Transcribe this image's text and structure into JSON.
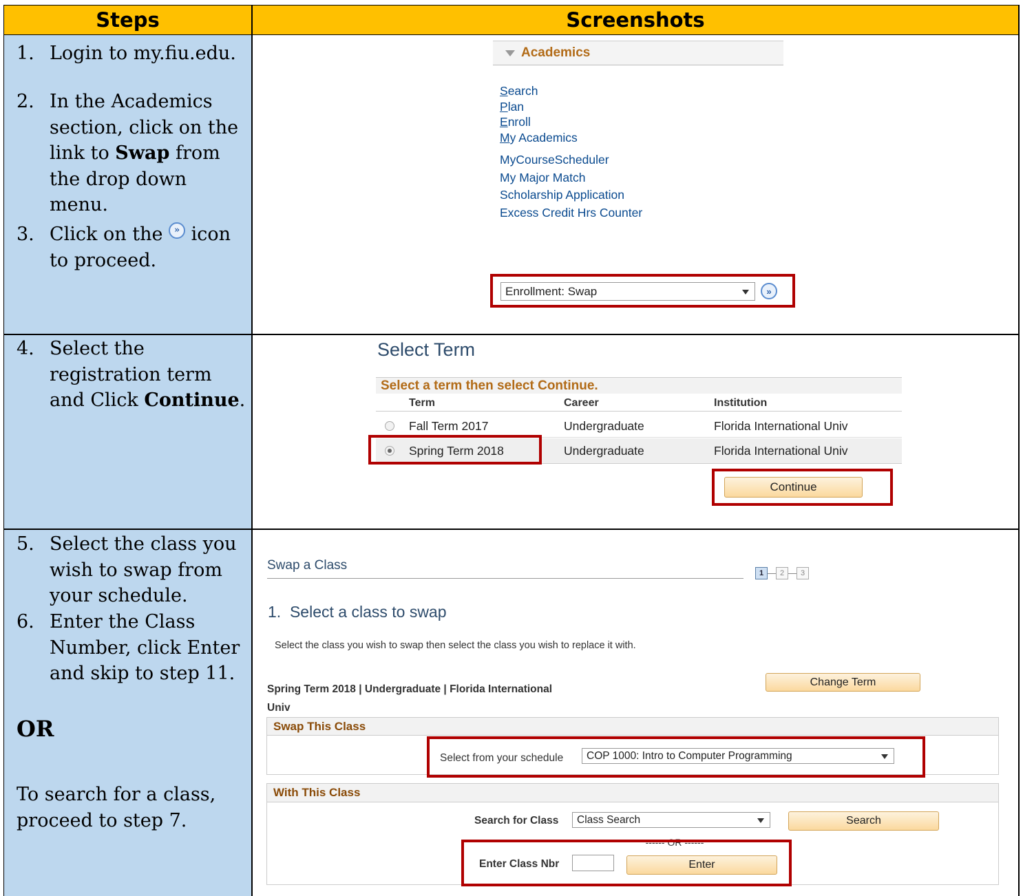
{
  "header": {
    "steps": "Steps",
    "screenshots": "Screenshots"
  },
  "row1": {
    "steps": [
      {
        "num": "1.",
        "lines": [
          "Login to my.fiu.edu."
        ]
      },
      {
        "num": "2.",
        "lines": [
          " In the Academics",
          "section, click on the",
          "link to ",
          "Swap",
          " from",
          "the drop down",
          "menu."
        ]
      },
      {
        "num": "3.",
        "lines": [
          "Click on the ",
          " icon",
          "to proceed."
        ]
      }
    ],
    "academics": {
      "title": "Academics",
      "links1": [
        {
          "first": "S",
          "rest": "earch"
        },
        {
          "first": "P",
          "rest": "lan"
        },
        {
          "first": "E",
          "rest": "nroll"
        },
        {
          "first": "M",
          "rest": "y Academics"
        }
      ],
      "links2": [
        "MyCourseScheduler",
        "My Major Match",
        "Scholarship Application",
        "Excess Credit Hrs Counter"
      ],
      "dropdown_value": "Enrollment: Swap"
    }
  },
  "row2": {
    "step": {
      "num": "4.",
      "l1": "Select the",
      "l2": "registration term",
      "l3a": "and Click ",
      "l3b": "Continue",
      "l3c": "."
    },
    "select_term": {
      "title": "Select Term",
      "instruction": "Select a term then select Continue.",
      "columns": [
        "Term",
        "Career",
        "Institution"
      ],
      "rows": [
        {
          "term": "Fall Term 2017",
          "career": "Undergraduate",
          "institution": "Florida International Univ",
          "selected": false
        },
        {
          "term": "Spring Term 2018",
          "career": "Undergraduate",
          "institution": "Florida International Univ",
          "selected": true
        }
      ],
      "continue": "Continue"
    }
  },
  "row3": {
    "steps": [
      {
        "num": "5.",
        "lines": [
          "Select the class you",
          "wish to swap from",
          "your schedule."
        ]
      },
      {
        "num": "6.",
        "lines": [
          "Enter the Class",
          "Number, click Enter",
          "and skip to step 11."
        ]
      }
    ],
    "or": "OR",
    "search_note": [
      "To search for a class,",
      "proceed to step 7."
    ],
    "swap": {
      "title": "Swap a Class",
      "progress": [
        "1",
        "2",
        "3"
      ],
      "subtitle": "1.  Select a class to swap",
      "instruction": "Select the class you wish to swap then select the class you wish to replace it with.",
      "term_info_1": "Spring Term 2018 | Undergraduate | Florida International",
      "term_info_2": "Univ",
      "change_term": "Change Term",
      "swap_this_class": "Swap This Class",
      "select_label": "Select from your schedule",
      "select_value": "COP 1000: Intro to Computer Programming",
      "with_this_class": "With This Class",
      "search_label": "Search for Class",
      "search_value": "Class Search",
      "search_button": "Search",
      "or_divider": "------ OR ------",
      "enter_label": "Enter Class Nbr",
      "enter_button": "Enter"
    }
  }
}
